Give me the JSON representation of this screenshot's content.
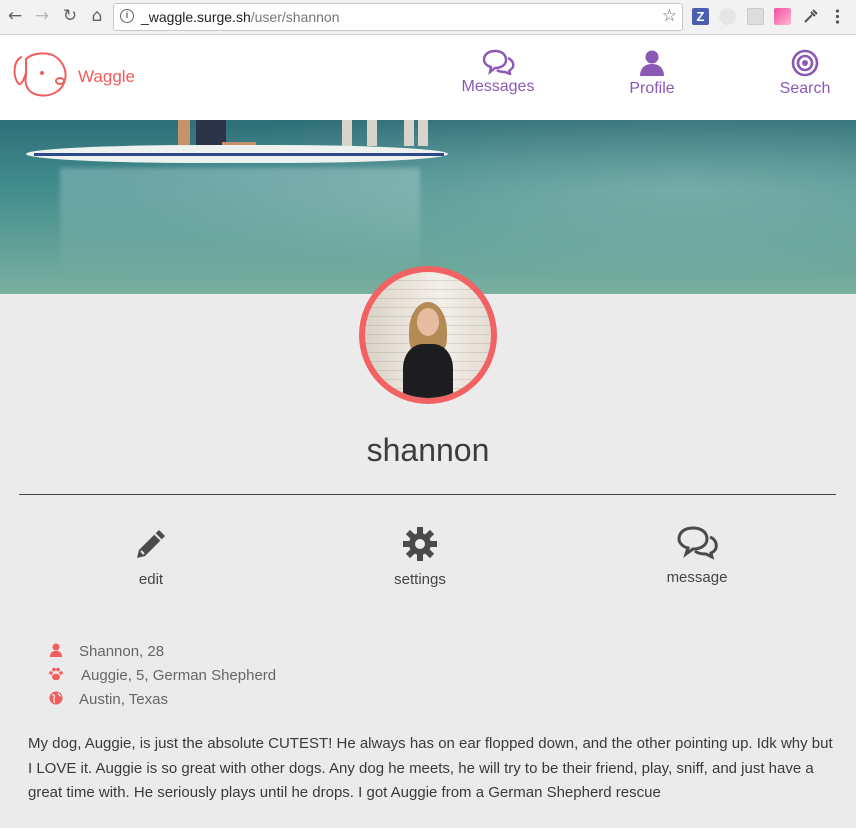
{
  "browser": {
    "url_host": "_waggle.surge.sh",
    "url_path": "/user/shannon",
    "back_glyph": "←",
    "forward_glyph": "→",
    "reload_glyph": "↻",
    "home_glyph": "⌂",
    "info_glyph": "i",
    "star_glyph": "☆"
  },
  "app": {
    "brand": "Waggle",
    "brand_color": "#f25c5c",
    "nav_color": "#8b58b6",
    "nav": [
      {
        "label": "Messages",
        "icon": "comments-icon"
      },
      {
        "label": "Profile",
        "icon": "user-icon"
      },
      {
        "label": "Search",
        "icon": "target-icon"
      }
    ]
  },
  "profile": {
    "username": "shannon",
    "actions": [
      {
        "label": "edit",
        "icon": "pencil-icon"
      },
      {
        "label": "settings",
        "icon": "gear-icon"
      },
      {
        "label": "message",
        "icon": "comments-icon"
      }
    ],
    "info": [
      {
        "text": "Shannon, 28",
        "icon": "user-icon"
      },
      {
        "text": "Auggie, 5, German Shepherd",
        "icon": "paw-icon"
      },
      {
        "text": "Austin, Texas",
        "icon": "globe-icon"
      }
    ],
    "bio": "My dog, Auggie, is just the absolute CUTEST! He always has on ear flopped down, and the other pointing up. Idk why but I LOVE it. Auggie is so great with other dogs. Any dog he meets, he will try to be their friend, play, sniff, and just have a great time with. He seriously plays until he drops. I got Auggie from a German Shepherd rescue",
    "accent_color": "#f26262"
  }
}
